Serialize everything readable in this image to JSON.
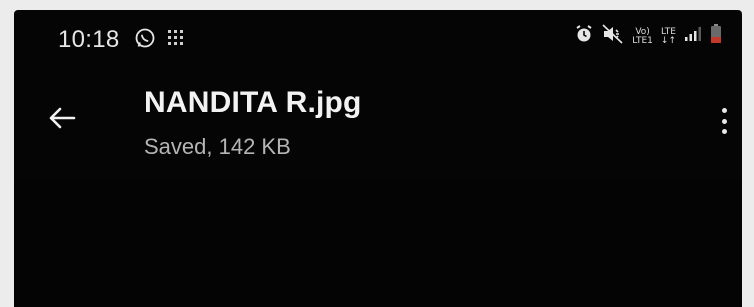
{
  "status_bar": {
    "time": "10:18",
    "left_icons": [
      "whatsapp-icon",
      "grid-notification-icon"
    ],
    "right_icons": [
      "alarm-icon",
      "mute-icon",
      "volte-icon",
      "lte-icon",
      "signal-icon",
      "battery-icon"
    ],
    "volte_label_top": "Vo)",
    "volte_label_bottom": "LTE1",
    "lte_label_top": "LTE",
    "lte_label_bottom": "↓↑"
  },
  "app_bar": {
    "title": "NANDITA R.jpg",
    "subtitle": "Saved, 142 KB",
    "back_icon": "arrow-left-icon",
    "more_icon": "more-vert-icon"
  },
  "colors": {
    "background": "#050505",
    "title_text": "#f2f2f2",
    "subtitle_text": "#b4b4b4",
    "battery_low": "#c0392b"
  }
}
